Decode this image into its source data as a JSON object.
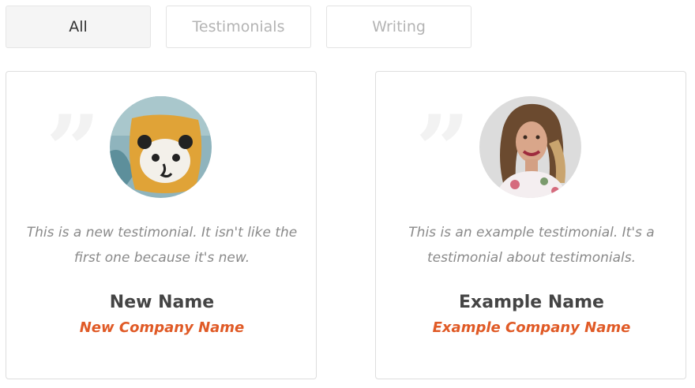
{
  "filters": [
    {
      "label": "All",
      "active": true
    },
    {
      "label": "Testimonials",
      "active": false
    },
    {
      "label": "Writing",
      "active": false
    }
  ],
  "testimonials": [
    {
      "quote_glyph": "”",
      "avatar": "plush-pillow-avatar",
      "text": "This is a new testimonial. It isn't like the first one because it's new.",
      "name": "New Name",
      "company": "New Company Name"
    },
    {
      "quote_glyph": "”",
      "avatar": "smiling-woman-avatar",
      "text": "This is an example testimonial. It's a testimonial about testimonials.",
      "name": "Example Name",
      "company": "Example Company Name"
    }
  ],
  "colors": {
    "accent": "#e05a26",
    "name": "#444444",
    "body_text": "#8a8a8a",
    "filter_inactive": "#b4b4b4"
  }
}
